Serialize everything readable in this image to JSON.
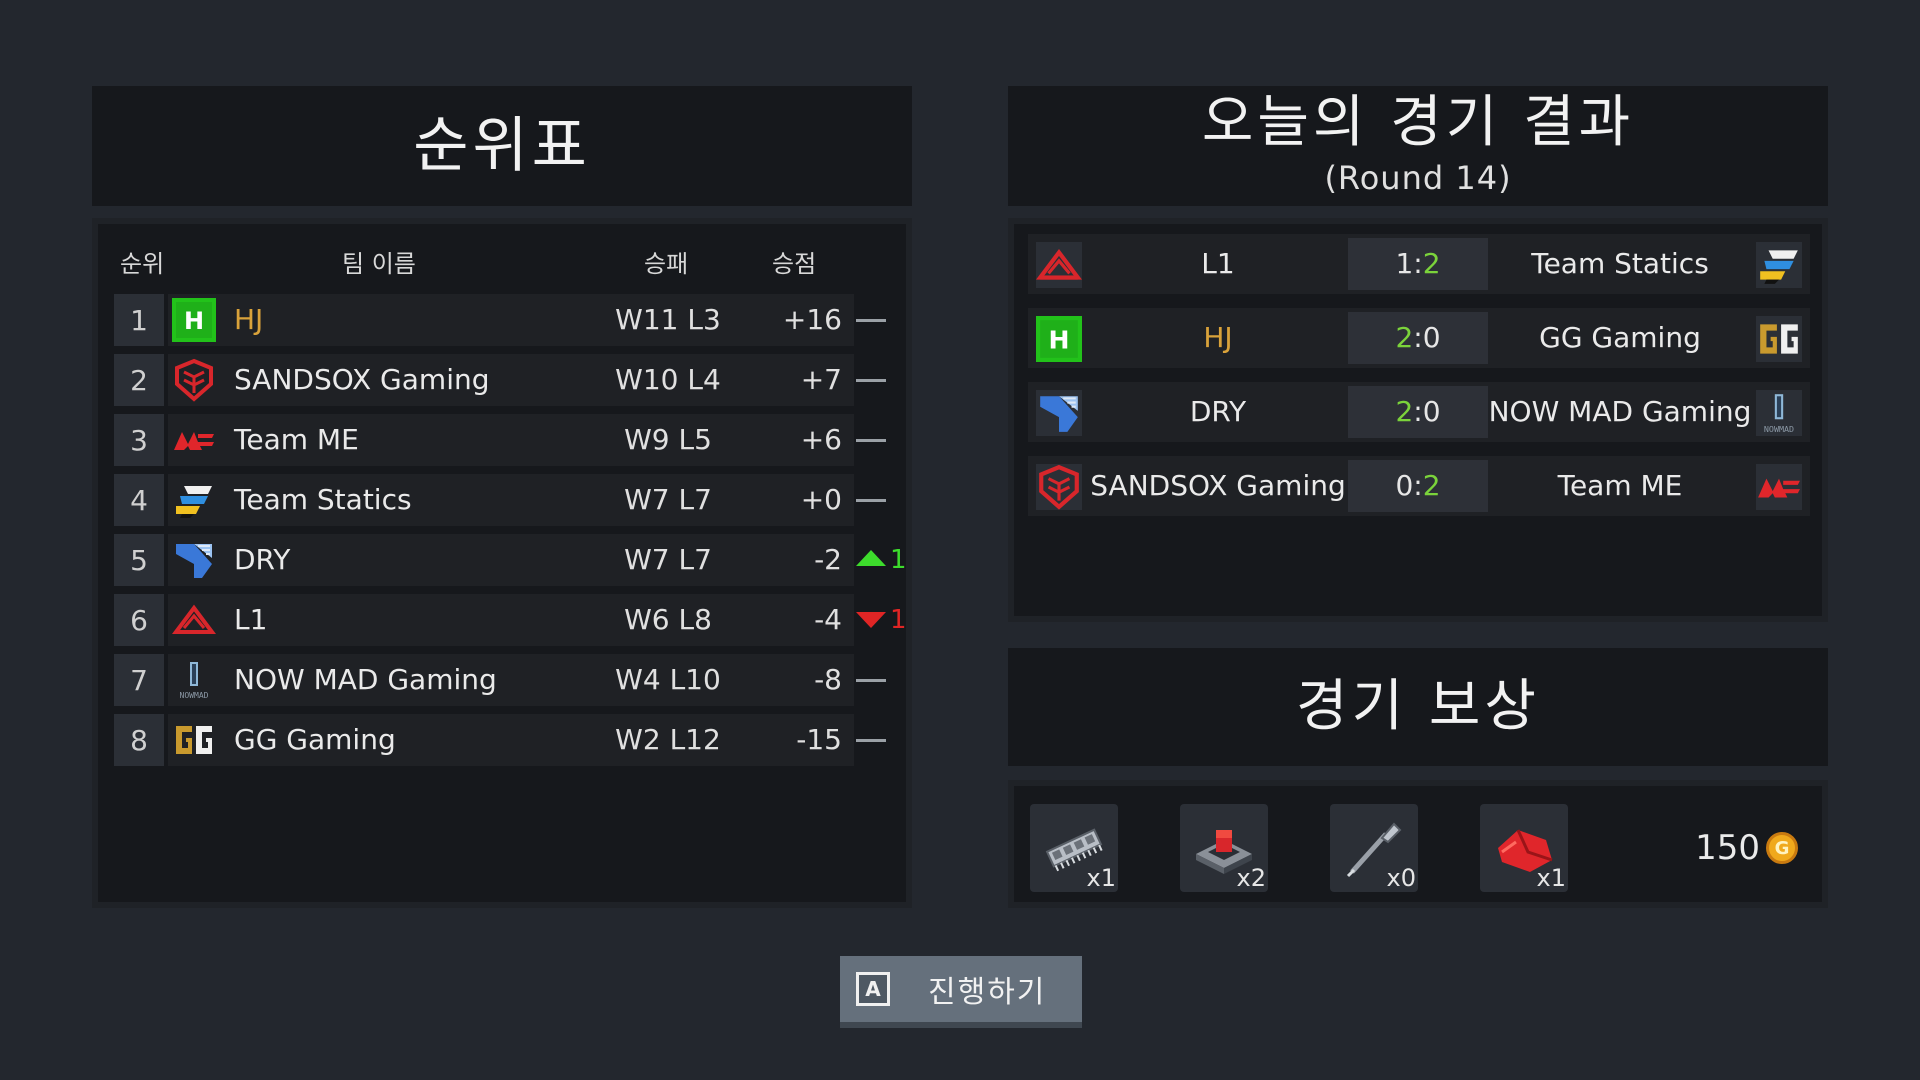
{
  "standings": {
    "title": "순위표",
    "headers": {
      "rank": "순위",
      "team": "팀 이름",
      "record": "승패",
      "points": "승점"
    },
    "rows": [
      {
        "rank": "1",
        "logo": "hj-logo",
        "name": "HJ",
        "record": "W11 L3",
        "points": "+16",
        "trend": "none",
        "trend_value": ""
      },
      {
        "rank": "2",
        "logo": "sandsox-logo",
        "name": "SANDSOX Gaming",
        "record": "W10 L4",
        "points": "+7",
        "trend": "none",
        "trend_value": ""
      },
      {
        "rank": "3",
        "logo": "team-me-logo",
        "name": "Team ME",
        "record": "W9 L5",
        "points": "+6",
        "trend": "none",
        "trend_value": ""
      },
      {
        "rank": "4",
        "logo": "team-statics-logo",
        "name": "Team Statics",
        "record": "W7 L7",
        "points": "+0",
        "trend": "none",
        "trend_value": ""
      },
      {
        "rank": "5",
        "logo": "dry-logo",
        "name": "DRY",
        "record": "W7 L7",
        "points": "-2",
        "trend": "up",
        "trend_value": "1"
      },
      {
        "rank": "6",
        "logo": "l1-logo",
        "name": "L1",
        "record": "W6 L8",
        "points": "-4",
        "trend": "down",
        "trend_value": "1"
      },
      {
        "rank": "7",
        "logo": "now-mad-logo",
        "name": "NOW MAD Gaming",
        "record": "W4 L10",
        "points": "-8",
        "trend": "none",
        "trend_value": ""
      },
      {
        "rank": "8",
        "logo": "gg-gaming-logo",
        "name": "GG Gaming",
        "record": "W2 L12",
        "points": "-15",
        "trend": "none",
        "trend_value": ""
      }
    ]
  },
  "results": {
    "title": "오늘의 경기 결과",
    "subtitle": "(Round 14)",
    "matches": [
      {
        "left_logo": "l1-logo",
        "left": "L1",
        "score_left": "1",
        "sep": ":",
        "score_right": "2",
        "winner": "right",
        "right": "Team Statics",
        "right_logo": "team-statics-logo"
      },
      {
        "left_logo": "hj-logo",
        "left": "HJ",
        "score_left": "2",
        "sep": ":",
        "score_right": "0",
        "winner": "left",
        "right": "GG Gaming",
        "right_logo": "gg-gaming-logo"
      },
      {
        "left_logo": "dry-logo",
        "left": "DRY",
        "score_left": "2",
        "sep": ":",
        "score_right": "0",
        "winner": "left",
        "right": "NOW MAD Gaming",
        "right_logo": "now-mad-logo"
      },
      {
        "left_logo": "sandsox-logo",
        "left": "SANDSOX Gaming",
        "score_left": "0",
        "sep": ":",
        "score_right": "2",
        "winner": "right",
        "right": "Team ME",
        "right_logo": "team-me-logo"
      }
    ]
  },
  "rewards": {
    "title": "경기 보상",
    "items": [
      {
        "icon": "ram-chip-icon",
        "qty": "x1"
      },
      {
        "icon": "red-button-switch-icon",
        "qty": "x2"
      },
      {
        "icon": "screwdriver-icon",
        "qty": "x0"
      },
      {
        "icon": "red-cloth-icon",
        "qty": "x1"
      }
    ],
    "gold": "150",
    "coin_symbol": "G"
  },
  "proceed": {
    "key": "A",
    "label": "진행하기"
  },
  "colors": {
    "highlight_team": "#d9a23a",
    "win_score": "#7bd33b",
    "trend_up": "#3ddc2c",
    "trend_down": "#e02525"
  }
}
